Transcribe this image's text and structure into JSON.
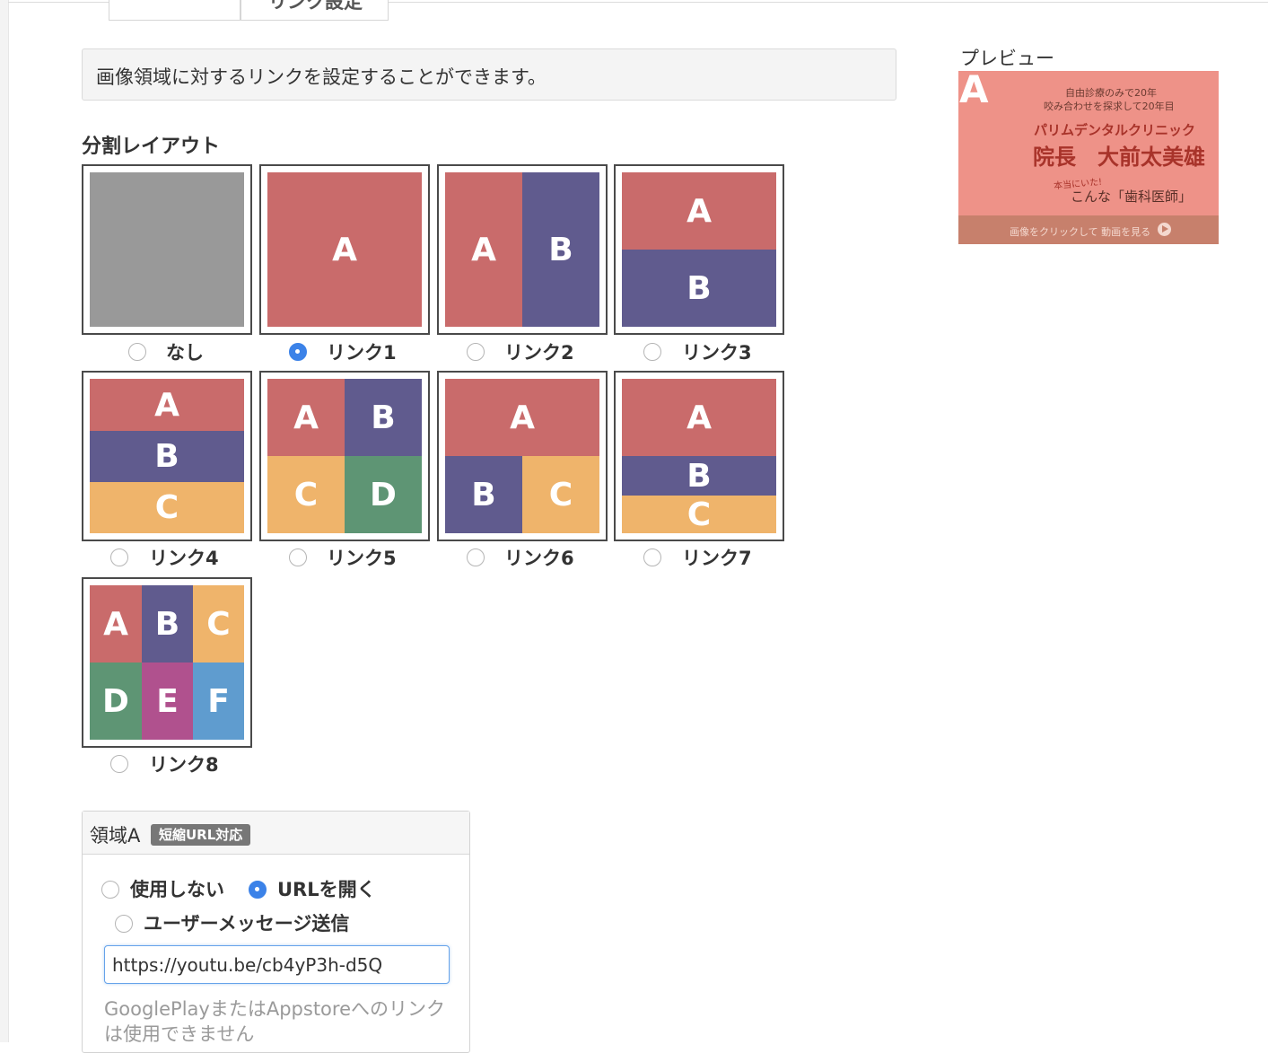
{
  "tabs": [
    {
      "label": ""
    },
    {
      "label": "リンク設定"
    }
  ],
  "info": {
    "text": "画像領域に対するリンクを設定することができます。"
  },
  "layout_section": {
    "title": "分割レイアウト"
  },
  "layouts": [
    {
      "label": "なし",
      "checked": false
    },
    {
      "label": "リンク1",
      "checked": true
    },
    {
      "label": "リンク2",
      "checked": false
    },
    {
      "label": "リンク3",
      "checked": false
    },
    {
      "label": "リンク4",
      "checked": false
    },
    {
      "label": "リンク5",
      "checked": false
    },
    {
      "label": "リンク6",
      "checked": false
    },
    {
      "label": "リンク7",
      "checked": false
    },
    {
      "label": "リンク8",
      "checked": false
    }
  ],
  "region_letters": [
    "A",
    "B",
    "C",
    "D",
    "E",
    "F"
  ],
  "colors": {
    "region_red": "#c96b6b",
    "region_navy": "#605b8e",
    "region_orange": "#efb46b",
    "region_green": "#5e9574",
    "region_pink": "#b0518e",
    "region_blue": "#5f9ccf",
    "none_gray": "#999999",
    "accent": "#3b82e8"
  },
  "preview": {
    "title": "プレビュー",
    "overlay_letter": "A",
    "banner": {
      "line1": "自由診療のみで20年",
      "line2": "咬み合わせを探求して20年目",
      "line3": "パリムデンタルクリニック",
      "line4": "院長　大前太美雄",
      "line5": "本当にいた!",
      "line6": "こんな「歯科医師」",
      "cta": "画像をクリックして 動画を見る"
    }
  },
  "region_panel": {
    "title": "領域A",
    "badge": "短縮URL対応",
    "options": [
      {
        "label": "使用しない",
        "checked": false
      },
      {
        "label": "URLを開く",
        "checked": true
      },
      {
        "label": "ユーザーメッセージ送信",
        "checked": false
      }
    ],
    "url_value": "https://youtu.be/cb4yP3h-d5Q",
    "help": "GooglePlayまたはAppstoreへのリンクは使用できません"
  }
}
